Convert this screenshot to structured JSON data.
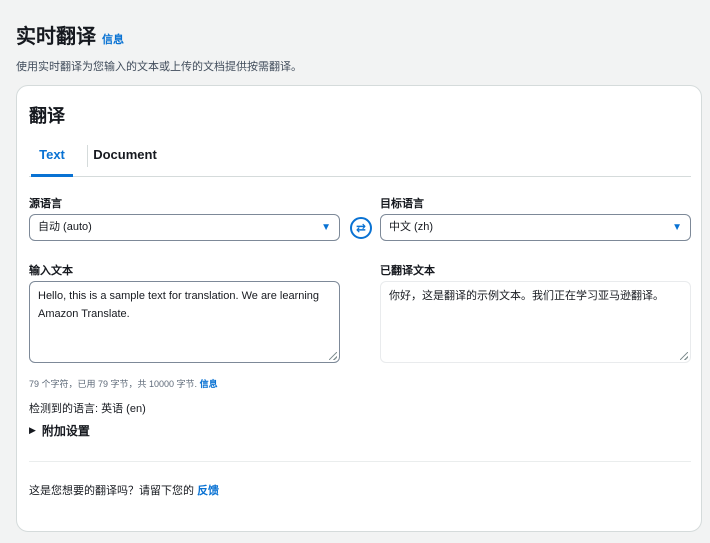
{
  "header": {
    "title": "实时翻译",
    "info_link": "信息",
    "subtitle": "使用实时翻译为您输入的文本或上传的文档提供按需翻译。"
  },
  "card": {
    "title": "翻译",
    "tabs": [
      "Text",
      "Document"
    ],
    "active_tab": "Text"
  },
  "source": {
    "label": "源语言",
    "selected": "自动 (auto)",
    "input_label": "输入文本",
    "input_value": "Hello, this is a sample text for translation. We are learning Amazon Translate.",
    "counter": "79 个字符，已用 79 字节，共 10000 字节.",
    "counter_link": "信息",
    "detected": "检测到的语言: 英语 (en)"
  },
  "target": {
    "label": "目标语言",
    "selected": "中文 (zh)",
    "output_label": "已翻译文本",
    "output_value": "你好，这是翻译的示例文本。我们正在学习亚马逊翻译。"
  },
  "swap_glyph": "⇄",
  "caret_glyph": "▼",
  "additional_settings": {
    "label": "附加设置",
    "glyph": "▶"
  },
  "feedback": {
    "text": "这是您想要的翻译吗？请留下您的",
    "link": "反馈"
  },
  "colors": {
    "accent": "#0972d3",
    "border": "#7d8998",
    "background": "#f2f3f3"
  }
}
